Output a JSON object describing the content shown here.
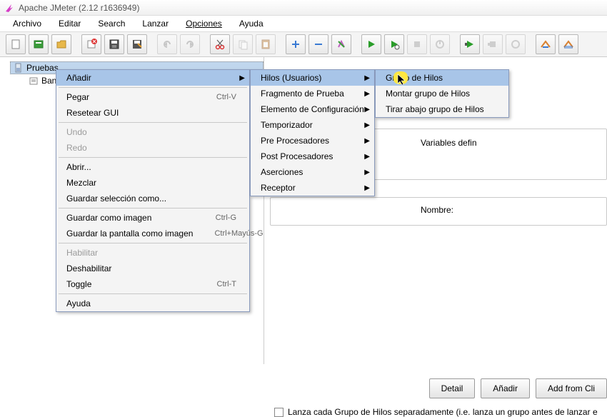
{
  "window": {
    "title": "Apache JMeter (2.12 r1636949)"
  },
  "menubar": [
    "Archivo",
    "Editar",
    "Search",
    "Lanzar",
    "Opciones",
    "Ayuda"
  ],
  "tree": {
    "root": "Pruebas",
    "child": "Banco"
  },
  "rightpane": {
    "vars_heading": "Variables defin",
    "name_label": "Nombre:",
    "buttons": {
      "detail": "Detail",
      "add": "Añadir",
      "addfrom": "Add from Cli"
    },
    "check_label": "Lanza cada Grupo de Hilos separadamente (i.e. lanza un grupo antes de lanzar e"
  },
  "context_menu": [
    {
      "label": "Añadir",
      "shortcut": "",
      "hl": true,
      "arrow": true
    },
    {
      "sep": true
    },
    {
      "label": "Pegar",
      "shortcut": "Ctrl-V"
    },
    {
      "label": "Resetear GUI"
    },
    {
      "sep": true
    },
    {
      "label": "Undo",
      "disabled": true
    },
    {
      "label": "Redo",
      "disabled": true
    },
    {
      "sep": true
    },
    {
      "label": "Abrir..."
    },
    {
      "label": "Mezclar"
    },
    {
      "label": "Guardar selección como..."
    },
    {
      "sep": true
    },
    {
      "label": "Guardar como imagen",
      "shortcut": "Ctrl-G"
    },
    {
      "label": "Guardar la pantalla como imagen",
      "shortcut": "Ctrl+Mayús-G"
    },
    {
      "sep": true
    },
    {
      "label": "Habilitar",
      "disabled": true
    },
    {
      "label": "Deshabilitar"
    },
    {
      "label": "Toggle",
      "shortcut": "Ctrl-T"
    },
    {
      "sep": true
    },
    {
      "label": "Ayuda"
    }
  ],
  "submenu_add": [
    {
      "label": "Hilos (Usuarios)",
      "hl": true
    },
    {
      "label": "Fragmento de Prueba"
    },
    {
      "label": "Elemento de Configuración"
    },
    {
      "label": "Temporizador"
    },
    {
      "label": "Pre Procesadores"
    },
    {
      "label": "Post Procesadores"
    },
    {
      "label": "Aserciones"
    },
    {
      "label": "Receptor"
    }
  ],
  "submenu_threads": [
    {
      "label": "Grupo de Hilos",
      "hl": true
    },
    {
      "label": "Montar grupo de Hilos"
    },
    {
      "label": "Tirar abajo grupo de Hilos"
    }
  ],
  "colors": {
    "accent": "#a8c5e8",
    "highlight": "#ffe840"
  }
}
